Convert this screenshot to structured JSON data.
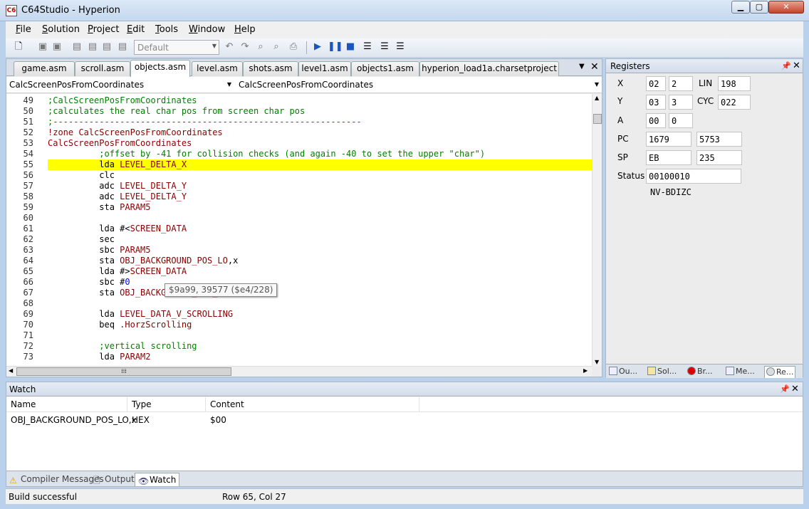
{
  "window": {
    "title": "C64Studio - Hyperion",
    "icon_text": "C6",
    "min": "▁",
    "max": "▢",
    "close": "✕"
  },
  "menu": [
    {
      "pre": "",
      "u": "F",
      "post": "ile"
    },
    {
      "pre": "",
      "u": "S",
      "post": "olution"
    },
    {
      "pre": "",
      "u": "P",
      "post": "roject"
    },
    {
      "pre": "",
      "u": "E",
      "post": "dit"
    },
    {
      "pre": "",
      "u": "T",
      "post": "ools"
    },
    {
      "pre": "",
      "u": "W",
      "post": "indow"
    },
    {
      "pre": "",
      "u": "H",
      "post": "elp"
    }
  ],
  "toolbar": {
    "config": "Default"
  },
  "tabs": [
    {
      "label": "game.asm"
    },
    {
      "label": "scroll.asm"
    },
    {
      "label": "objects.asm",
      "active": true
    },
    {
      "label": "level.asm"
    },
    {
      "label": "shots.asm"
    },
    {
      "label": "level1.asm"
    },
    {
      "label": "objects1.asm"
    },
    {
      "label": "hyperion_load1a.charsetproject"
    }
  ],
  "nav": {
    "left": "CalcScreenPosFromCoordinates",
    "right": "CalcScreenPosFromCoordinates"
  },
  "code": [
    {
      "n": "49",
      "parts": [
        {
          "c": "comment",
          "t": ";CalcScreenPosFromCoordinates"
        }
      ]
    },
    {
      "n": "50",
      "parts": [
        {
          "c": "comment",
          "t": ";calculates the real char pos from screen char pos"
        }
      ]
    },
    {
      "n": "51",
      "parts": [
        {
          "c": "comment",
          "t": ";------------------------------------------------------------"
        }
      ]
    },
    {
      "n": "52",
      "parts": [
        {
          "c": "zone",
          "t": "!zone CalcScreenPosFromCoordinates"
        }
      ]
    },
    {
      "n": "53",
      "parts": [
        {
          "c": "label",
          "t": "CalcScreenPosFromCoordinates"
        }
      ]
    },
    {
      "n": "54",
      "parts": [
        {
          "c": "comment",
          "t": "          ;offset by -41 for collision checks (and again -40 to set the upper \"char\")"
        }
      ]
    },
    {
      "n": "55",
      "hl": true,
      "parts": [
        {
          "c": "op",
          "t": "          lda "
        },
        {
          "c": "label",
          "t": "LEVEL_DELTA_X"
        }
      ]
    },
    {
      "n": "56",
      "parts": [
        {
          "c": "op",
          "t": "          clc"
        }
      ]
    },
    {
      "n": "57",
      "parts": [
        {
          "c": "op",
          "t": "          adc "
        },
        {
          "c": "label",
          "t": "LEVEL_DELTA_Y"
        }
      ]
    },
    {
      "n": "58",
      "parts": [
        {
          "c": "op",
          "t": "          adc "
        },
        {
          "c": "label",
          "t": "LEVEL_DELTA_Y"
        }
      ]
    },
    {
      "n": "59",
      "parts": [
        {
          "c": "op",
          "t": "          sta "
        },
        {
          "c": "label",
          "t": "PARAM5"
        }
      ]
    },
    {
      "n": "60",
      "parts": []
    },
    {
      "n": "61",
      "parts": [
        {
          "c": "op",
          "t": "          lda #<"
        },
        {
          "c": "label",
          "t": "SCREEN_DATA"
        }
      ]
    },
    {
      "n": "62",
      "parts": [
        {
          "c": "op",
          "t": "          sec"
        }
      ]
    },
    {
      "n": "63",
      "parts": [
        {
          "c": "op",
          "t": "          sbc "
        },
        {
          "c": "label",
          "t": "PARAM5"
        }
      ]
    },
    {
      "n": "64",
      "parts": [
        {
          "c": "op",
          "t": "          sta "
        },
        {
          "c": "label",
          "t": "OBJ_BACKGROUND_POS_LO"
        },
        {
          "c": "op",
          "t": ",x"
        }
      ]
    },
    {
      "n": "65",
      "parts": [
        {
          "c": "op",
          "t": "          lda #>"
        },
        {
          "c": "label",
          "t": "SCREEN_DATA"
        }
      ]
    },
    {
      "n": "66",
      "parts": [
        {
          "c": "op",
          "t": "          sbc #"
        },
        {
          "c": "num",
          "t": "0"
        }
      ]
    },
    {
      "n": "67",
      "parts": [
        {
          "c": "op",
          "t": "          sta "
        },
        {
          "c": "label",
          "t": "OBJ_BACKGROUND_POS_HI"
        },
        {
          "c": "op",
          "t": ",x"
        }
      ]
    },
    {
      "n": "68",
      "parts": []
    },
    {
      "n": "69",
      "parts": [
        {
          "c": "op",
          "t": "          lda "
        },
        {
          "c": "label",
          "t": "LEVEL_DATA_V_SCROLLING"
        }
      ]
    },
    {
      "n": "70",
      "parts": [
        {
          "c": "op",
          "t": "          beq "
        },
        {
          "c": "label",
          "t": ".HorzScrolling"
        }
      ]
    },
    {
      "n": "71",
      "parts": []
    },
    {
      "n": "72",
      "parts": [
        {
          "c": "comment",
          "t": "          ;vertical scrolling"
        }
      ]
    },
    {
      "n": "73",
      "parts": [
        {
          "c": "op",
          "t": "          lda "
        },
        {
          "c": "label",
          "t": "PARAM2"
        }
      ]
    }
  ],
  "tooltip": "$9a99, 39577 ($e4/228)",
  "registers": {
    "title": "Registers",
    "x_label": "X",
    "x_hex": "02",
    "x_dec": "2",
    "y_label": "Y",
    "y_hex": "03",
    "y_dec": "3",
    "a_label": "A",
    "a_hex": "00",
    "a_dec": "0",
    "pc_label": "PC",
    "pc_hex": "1679",
    "pc_dec": "5753",
    "sp_label": "SP",
    "sp_hex": "EB",
    "sp_dec": "235",
    "lin_label": "LIN",
    "lin": "198",
    "cyc_label": "CYC",
    "cyc": "022",
    "status_label": "Status",
    "status": "00100010",
    "flags": "NV-BDIZC"
  },
  "side_tabs": [
    {
      "label": "Ou...",
      "icon": "outline-icon"
    },
    {
      "label": "Sol...",
      "icon": "solution-icon"
    },
    {
      "label": "Br...",
      "icon": "breakpoint-icon"
    },
    {
      "label": "Me...",
      "icon": "memory-icon"
    },
    {
      "label": "Re...",
      "icon": "registers-icon",
      "active": true
    }
  ],
  "watch": {
    "title": "Watch",
    "columns": [
      "Name",
      "Type",
      "Content"
    ],
    "rows": [
      {
        "name": "OBJ_BACKGROUND_POS_LO,x",
        "type": "HEX",
        "content": "$00"
      }
    ]
  },
  "bottom_tabs": [
    {
      "label": "Compiler Messages",
      "icon": "warning-icon"
    },
    {
      "label": "Output",
      "icon": "output-icon"
    },
    {
      "label": "Watch",
      "icon": "watch-icon",
      "active": true
    }
  ],
  "status": {
    "text": "Build successful",
    "position": "Row 65, Col 27"
  }
}
